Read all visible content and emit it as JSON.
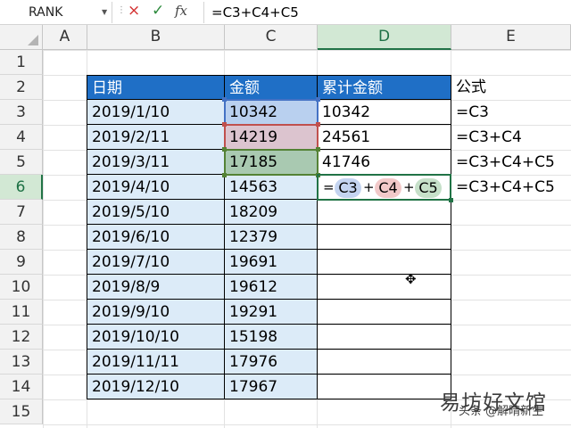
{
  "formula_bar": {
    "name_box": "RANK",
    "cancel_icon": "×",
    "enter_icon": "✓",
    "fx_label": "fx",
    "formula": "=C3+C4+C5"
  },
  "columns": [
    "A",
    "B",
    "C",
    "D",
    "E"
  ],
  "rows": [
    "1",
    "2",
    "3",
    "4",
    "5",
    "6",
    "7",
    "8",
    "9",
    "10",
    "11",
    "12",
    "13",
    "14",
    "15"
  ],
  "active_cell": {
    "column": "D",
    "row": "6"
  },
  "table": {
    "headers": {
      "date": "日期",
      "amount": "金额",
      "cumulative": "累计金额",
      "formula": "公式"
    },
    "dates": [
      "2019/1/10",
      "2019/2/11",
      "2019/3/11",
      "2019/4/10",
      "2019/5/10",
      "2019/6/10",
      "2019/7/10",
      "2019/8/9",
      "2019/9/10",
      "2019/10/10",
      "2019/11/11",
      "2019/12/10"
    ],
    "amounts": [
      "10342",
      "14219",
      "17185",
      "14563",
      "18209",
      "12379",
      "19691",
      "19612",
      "19291",
      "15198",
      "17976",
      "17967"
    ],
    "cumulative": [
      "10342",
      "24561",
      "41746"
    ],
    "formulas": [
      "=C3",
      "=C3+C4",
      "=C3+C4+C5",
      "=C3+C4+C5"
    ]
  },
  "edit_formula": {
    "equals": "=",
    "ref1": "C3",
    "plus1": "+",
    "ref2": "C4",
    "plus2": "+",
    "ref3": "C5"
  },
  "colors": {
    "header_blue": "#1f6fc6",
    "cell_blue": "#dcebf8",
    "ref_c3": "#4472c4",
    "ref_c4": "#c0504d",
    "ref_c5": "#548235",
    "selection_green": "#217346"
  },
  "watermark": {
    "main": "易坊好文馆",
    "sub": "头条 @解晴新生"
  }
}
